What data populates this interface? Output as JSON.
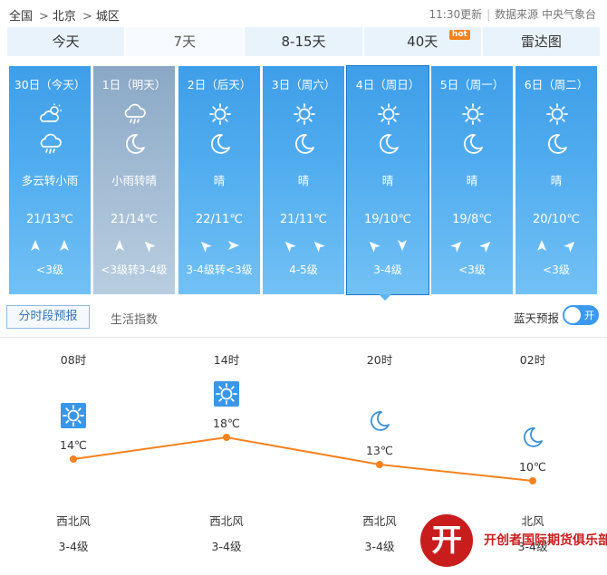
{
  "breadcrumb": {
    "items": [
      "全国",
      "北京",
      "城区"
    ],
    "separator": ">"
  },
  "meta": {
    "update": "11:30更新",
    "source": "数据来源 中央气象台"
  },
  "tabs": [
    {
      "label": "今天"
    },
    {
      "label": "7天"
    },
    {
      "label": "8-15天"
    },
    {
      "label": "40天",
      "badge": "hot"
    },
    {
      "label": "雷达图"
    }
  ],
  "days": [
    {
      "date": "30日（今天）",
      "desc": "多云转小雨",
      "temp": "21/13℃",
      "level": "<3级",
      "icons": [
        "partly-cloudy-icon",
        "light-rain-icon"
      ],
      "wind": [
        "n",
        "n"
      ]
    },
    {
      "date": "1日（明天）",
      "desc": "小雨转晴",
      "temp": "21/14℃",
      "level": "<3级转3-4级",
      "icons": [
        "light-rain-icon",
        "moon-icon"
      ],
      "wind": [
        "n",
        "nw"
      ]
    },
    {
      "date": "2日（后天）",
      "desc": "晴",
      "temp": "22/11℃",
      "level": "3-4级转<3级",
      "icons": [
        "sun-icon",
        "moon-icon"
      ],
      "wind": [
        "nw",
        "e"
      ]
    },
    {
      "date": "3日（周六）",
      "desc": "晴",
      "temp": "21/11℃",
      "level": "4-5级",
      "icons": [
        "sun-icon",
        "moon-icon"
      ],
      "wind": [
        "nw",
        "nw"
      ]
    },
    {
      "date": "4日（周日）",
      "desc": "晴",
      "temp": "19/10℃",
      "level": "3-4级",
      "icons": [
        "sun-icon",
        "moon-icon"
      ],
      "wind": [
        "nw",
        "s"
      ]
    },
    {
      "date": "5日（周一）",
      "desc": "晴",
      "temp": "19/8℃",
      "level": "<3级",
      "icons": [
        "sun-icon",
        "moon-icon"
      ],
      "wind": [
        "ne",
        "ne"
      ]
    },
    {
      "date": "6日（周二）",
      "desc": "晴",
      "temp": "20/10℃",
      "level": "<3级",
      "icons": [
        "sun-icon",
        "moon-icon"
      ],
      "wind": [
        "n",
        "ne"
      ]
    }
  ],
  "subtabs": {
    "hourly": "分时段预报",
    "life": "生活指数",
    "blue_sky": "蓝天预报",
    "toggle": "开"
  },
  "hourly": [
    {
      "time": "08时",
      "temp": "14℃",
      "temp_value": 14,
      "wind": "西北风",
      "level": "3-4级",
      "icon": "sun-icon"
    },
    {
      "time": "14时",
      "temp": "18℃",
      "temp_value": 18,
      "wind": "西北风",
      "level": "3-4级",
      "icon": "sun-icon"
    },
    {
      "time": "20时",
      "temp": "13℃",
      "temp_value": 13,
      "wind": "西北风",
      "level": "3-4级",
      "icon": "moon-icon"
    },
    {
      "time": "02时",
      "temp": "10℃",
      "temp_value": 10,
      "wind": "北风",
      "level": "3-4级",
      "icon": "moon-icon"
    }
  ],
  "colors": {
    "accent": "#3b9aef",
    "line": "#f5821f",
    "watermark": "#c91d1d"
  },
  "watermark": {
    "text": "开创者国际期货俱乐部"
  }
}
